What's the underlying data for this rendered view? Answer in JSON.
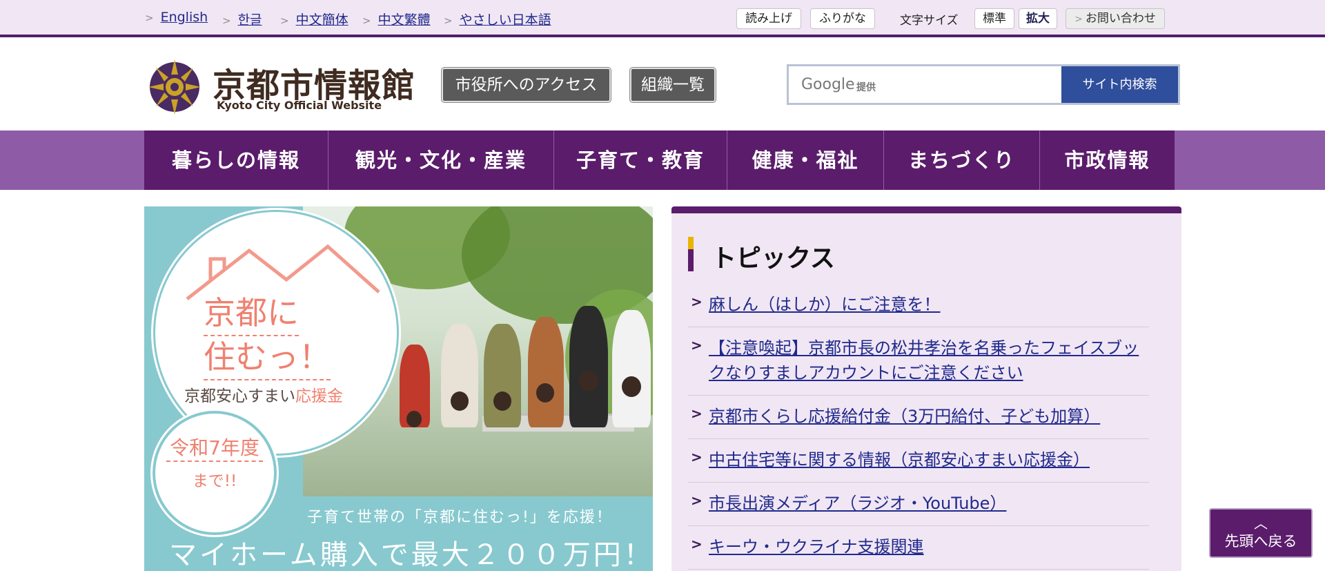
{
  "utility": {
    "languages": [
      "English",
      "한글",
      "中文簡体",
      "中文繁體",
      "やさしい日本語"
    ],
    "read_aloud": "読み上げ",
    "furigana": "ふりがな",
    "font_size_label": "文字サイズ",
    "font_standard": "標準",
    "font_large": "拡大",
    "contact": "お問い合わせ"
  },
  "header": {
    "site_name": "京都市情報館",
    "site_name_en": "Kyoto City Official Website",
    "access_button": "市役所へのアクセス",
    "org_button": "組織一覧",
    "search_google": "Google",
    "search_provided": "提供",
    "search_button": "サイト内検索"
  },
  "nav": {
    "items": [
      "暮らしの情報",
      "観光・文化・産業",
      "子育て・教育",
      "健康・福祉",
      "まちづくり",
      "市政情報"
    ]
  },
  "hero": {
    "title_line1": "京都に",
    "title_line2": "住むっ！",
    "subtitle_plain": "京都安心すまい",
    "subtitle_accent": "応援金",
    "year": "令和7年度",
    "until": "まで!!",
    "catch1": "子育て世帯の「京都に住むっ!」を応援！",
    "catch2": "マイホーム購入で最大２００万円！"
  },
  "topics": {
    "title": "トピックス",
    "items": [
      "麻しん（はしか）にご注意を！",
      "【注意喚起】京都市長の松井孝治を名乗ったフェイスブックなりすましアカウントにご注意ください",
      "京都市くらし応援給付金（3万円給付、子ども加算）",
      "中古住宅等に関する情報（京都安心すまい応援金）",
      "市長出演メディア（ラジオ・YouTube）",
      "キーウ・ウクライナ支援関連"
    ]
  },
  "back_to_top": "先頭へ戻る",
  "colors": {
    "primary_purple": "#5b1c6b",
    "nav_band": "#8e5ba7",
    "util_bg": "#f1e6f3",
    "link_blue": "#1f2a8c",
    "search_blue": "#2f4e9c",
    "hero_teal": "#87c9cf",
    "hero_coral": "#ef8170"
  }
}
